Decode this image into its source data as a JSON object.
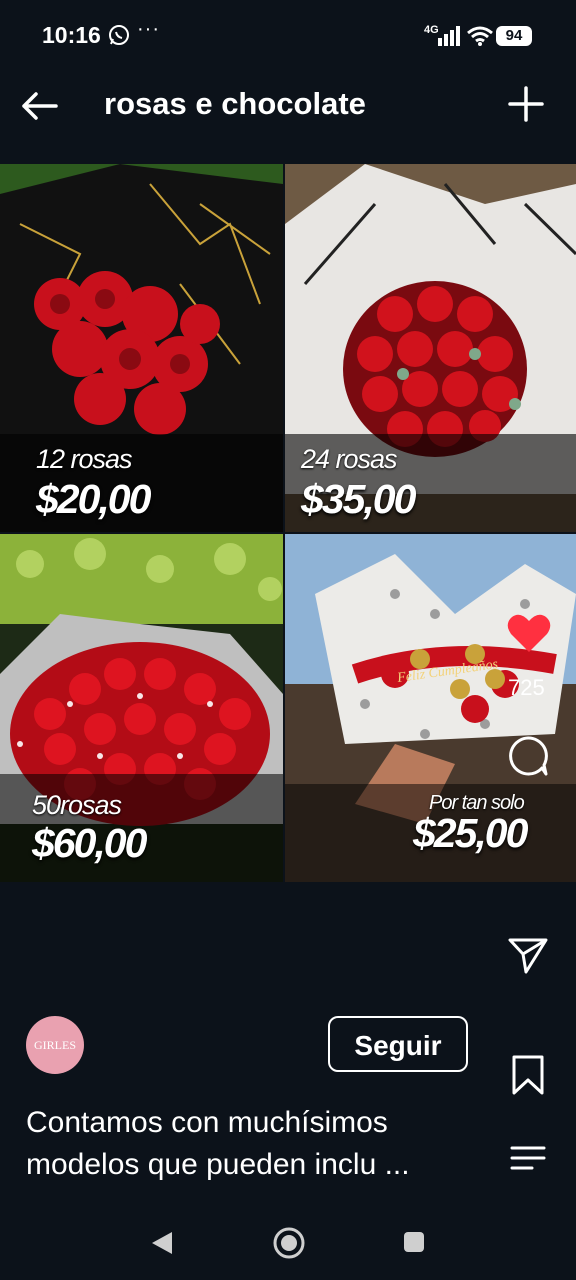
{
  "status_bar": {
    "time": "10:16",
    "more": "···",
    "network": "4G",
    "battery": "94",
    "icons": [
      "whatsapp-icon",
      "signal-icon",
      "wifi-icon",
      "battery-icon"
    ]
  },
  "header": {
    "title": "rosas e chocolate",
    "back_icon": "back-arrow-icon",
    "add_icon": "plus-icon"
  },
  "products": [
    {
      "qty": "12 rosas",
      "price": "$20,00"
    },
    {
      "qty": "24 rosas",
      "price": "$35,00"
    },
    {
      "qty": "50rosas",
      "price": "$60,00"
    },
    {
      "qty": "Por tan solo",
      "price": "$25,00"
    }
  ],
  "ribbon_text": "Feliz Cumpleaños",
  "actions": {
    "like_count": "725",
    "like_color": "#ff3040"
  },
  "account": {
    "avatar_text": "GIRLES",
    "avatar_color": "#e9a1b0",
    "follow_label": "Seguir"
  },
  "caption": "Contamos con muchísimos modelos que pueden inclu ...",
  "colors": {
    "background": "#0c121a",
    "rose_red": "#c8101c"
  }
}
